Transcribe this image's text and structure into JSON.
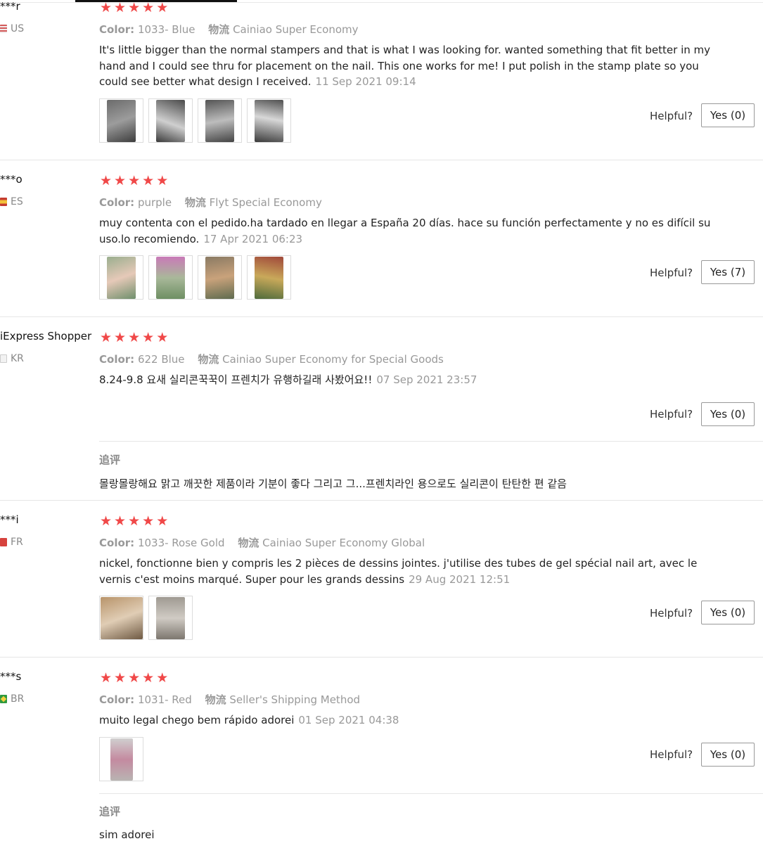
{
  "labels": {
    "color": "Color:",
    "logistics": "物流",
    "helpful": "Helpful?",
    "followup": "追评"
  },
  "reviews": [
    {
      "username": "***r",
      "country": "US",
      "rating": 5,
      "color": "1033- Blue",
      "shipping": "Cainiao Super Economy",
      "text": "It's little bigger than the normal stampers and that is what I was looking for. wanted something that fit better in my hand and I could see thru for placement on the nail. This one works for me! I put polish in the stamp plate so you could see better what design I received.",
      "date": "11 Sep 2021 09:14",
      "helpful": "Yes (0)",
      "photos": [
        "photo-1",
        "photo-2",
        "photo-3",
        "photo-4"
      ]
    },
    {
      "username": "***o",
      "country": "ES",
      "rating": 5,
      "color": "purple",
      "shipping": "Flyt Special Economy",
      "text": "muy contenta con el pedido.ha tardado en llegar a España 20 días. hace su función perfectamente y no es difícil su uso.lo recomiendo.",
      "date": "17 Apr 2021 06:23",
      "helpful": "Yes (7)",
      "photos": [
        "photo-1",
        "photo-2",
        "photo-3",
        "photo-4"
      ]
    },
    {
      "username": "iExpress Shopper",
      "country": "KR",
      "rating": 5,
      "color": "622 Blue",
      "shipping": "Cainiao Super Economy for Special Goods",
      "text": "8.24-9.8 요새 실리콘꾹꾹이 프렌치가 유행하길래 사봤어요!!",
      "date": "07 Sep 2021 23:57",
      "helpful": "Yes (0)",
      "followup": "몰랑몰랑해요 맑고 깨끗한 제품이라 기분이 좋다 그리고 그...프렌치라인 용으로도 실리콘이 탄탄한 편 같음"
    },
    {
      "username": "***i",
      "country": "FR",
      "rating": 5,
      "color": "1033- Rose Gold",
      "shipping": "Cainiao Super Economy Global",
      "text": "nickel, fonctionne bien y compris les 2 pièces de dessins jointes. j'utilise des tubes de gel spécial nail art, avec le vernis c'est moins marqué. Super pour les grands dessins",
      "date": "29 Aug 2021 12:51",
      "helpful": "Yes (0)",
      "photos": [
        "photo-1",
        "photo-2"
      ]
    },
    {
      "username": "***s",
      "country": "BR",
      "rating": 5,
      "color": "1031- Red",
      "shipping": "Seller's Shipping Method",
      "text": "muito legal chego bem rápido adorei",
      "date": "01 Sep 2021 04:38",
      "helpful": "Yes (0)",
      "photos": [
        "photo-1"
      ],
      "followup": "sim adorei"
    }
  ],
  "colors": {
    "star": "#f04848",
    "muted": "#999999",
    "text": "#222222",
    "divider": "#e6e6e6"
  }
}
